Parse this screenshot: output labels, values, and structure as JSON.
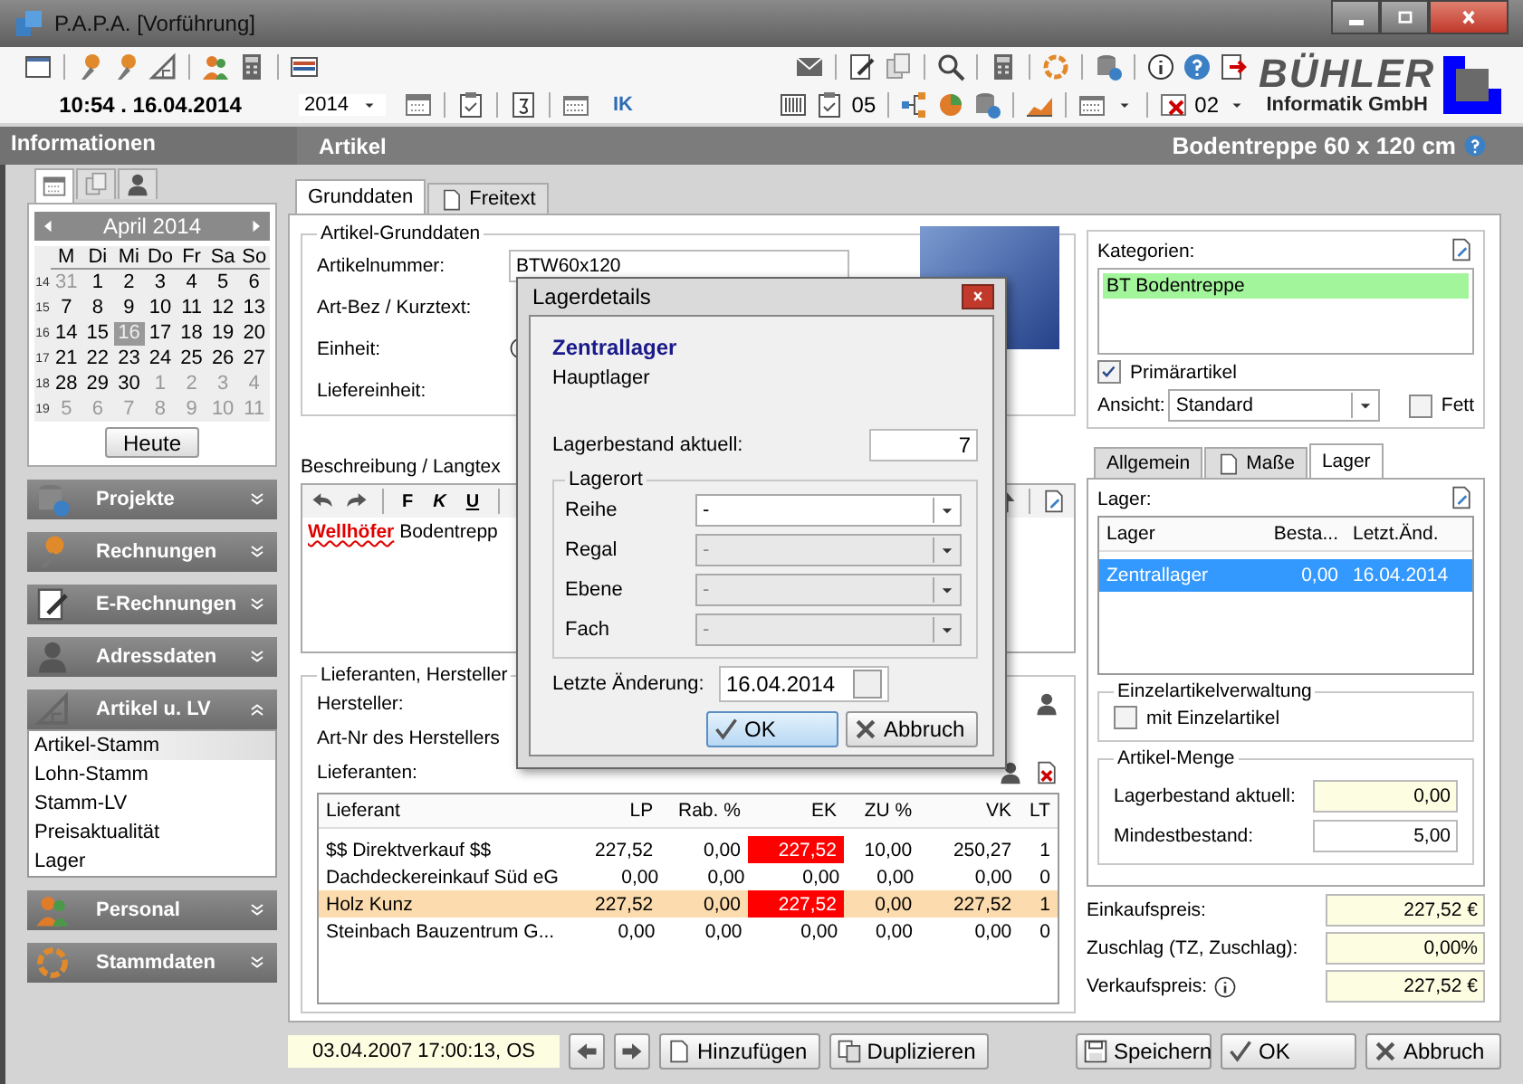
{
  "window": {
    "title": "P.A.P.A. [Vorführung]"
  },
  "toolbar": {
    "clock": "10:54 . 16.04.2014",
    "year": "2014",
    "ik": "IK",
    "count_a": "05",
    "count_b": "02"
  },
  "logo": {
    "name": "BÜHLER",
    "subtitle": "Informatik GmbH"
  },
  "info_header": "Informationen",
  "module_header": {
    "title": "Artikel",
    "item": "Bodentreppe 60 x 120 cm"
  },
  "info_tabs": [
    {
      "kind": "calendar",
      "selected": true
    },
    {
      "kind": "book",
      "selected": false
    },
    {
      "kind": "phone",
      "selected": false
    }
  ],
  "calendar": {
    "month": "April 2014",
    "weekdays": [
      "M",
      "Di",
      "Mi",
      "Do",
      "Fr",
      "Sa",
      "So"
    ],
    "today_button": "Heute",
    "weeks": [
      {
        "number": "14",
        "days": [
          {
            "day": "31",
            "outside": true,
            "selected": false
          },
          {
            "day": "1",
            "outside": false,
            "selected": false
          },
          {
            "day": "2",
            "outside": false,
            "selected": false
          },
          {
            "day": "3",
            "outside": false,
            "selected": false
          },
          {
            "day": "4",
            "outside": false,
            "selected": false
          },
          {
            "day": "5",
            "outside": false,
            "selected": false
          },
          {
            "day": "6",
            "outside": false,
            "selected": false
          }
        ]
      },
      {
        "number": "15",
        "days": [
          {
            "day": "7",
            "outside": false,
            "selected": false
          },
          {
            "day": "8",
            "outside": false,
            "selected": false
          },
          {
            "day": "9",
            "outside": false,
            "selected": false
          },
          {
            "day": "10",
            "outside": false,
            "selected": false
          },
          {
            "day": "11",
            "outside": false,
            "selected": false
          },
          {
            "day": "12",
            "outside": false,
            "selected": false
          },
          {
            "day": "13",
            "outside": false,
            "selected": false
          }
        ]
      },
      {
        "number": "16",
        "days": [
          {
            "day": "14",
            "outside": false,
            "selected": false
          },
          {
            "day": "15",
            "outside": false,
            "selected": false
          },
          {
            "day": "16",
            "outside": false,
            "selected": true
          },
          {
            "day": "17",
            "outside": false,
            "selected": false
          },
          {
            "day": "18",
            "outside": false,
            "selected": false
          },
          {
            "day": "19",
            "outside": false,
            "selected": false
          },
          {
            "day": "20",
            "outside": false,
            "selected": false
          }
        ]
      },
      {
        "number": "17",
        "days": [
          {
            "day": "21",
            "outside": false,
            "selected": false
          },
          {
            "day": "22",
            "outside": false,
            "selected": false
          },
          {
            "day": "23",
            "outside": false,
            "selected": false
          },
          {
            "day": "24",
            "outside": false,
            "selected": false
          },
          {
            "day": "25",
            "outside": false,
            "selected": false
          },
          {
            "day": "26",
            "outside": false,
            "selected": false
          },
          {
            "day": "27",
            "outside": false,
            "selected": false
          }
        ]
      },
      {
        "number": "18",
        "days": [
          {
            "day": "28",
            "outside": false,
            "selected": false
          },
          {
            "day": "29",
            "outside": false,
            "selected": false
          },
          {
            "day": "30",
            "outside": false,
            "selected": false
          },
          {
            "day": "1",
            "outside": true,
            "selected": false
          },
          {
            "day": "2",
            "outside": true,
            "selected": false
          },
          {
            "day": "3",
            "outside": true,
            "selected": false
          },
          {
            "day": "4",
            "outside": true,
            "selected": false
          }
        ]
      },
      {
        "number": "19",
        "days": [
          {
            "day": "5",
            "outside": true,
            "selected": false
          },
          {
            "day": "6",
            "outside": true,
            "selected": false
          },
          {
            "day": "7",
            "outside": true,
            "selected": false
          },
          {
            "day": "8",
            "outside": true,
            "selected": false
          },
          {
            "day": "9",
            "outside": true,
            "selected": false
          },
          {
            "day": "10",
            "outside": true,
            "selected": false
          },
          {
            "day": "11",
            "outside": true,
            "selected": false
          }
        ]
      }
    ]
  },
  "nav": [
    {
      "label": "Projekte",
      "kind": "projects",
      "expanded": false
    },
    {
      "label": "Rechnungen",
      "kind": "invoices",
      "expanded": false
    },
    {
      "label": "E-Rechnungen",
      "kind": "einvoices",
      "expanded": false
    },
    {
      "label": "Adressdaten",
      "kind": "addresses",
      "expanded": false
    },
    {
      "label": "Artikel u. LV",
      "kind": "articles",
      "expanded": true,
      "items": [
        {
          "label": "Artikel-Stamm",
          "selected": true
        },
        {
          "label": "Lohn-Stamm",
          "selected": false
        },
        {
          "label": "Stamm-LV",
          "selected": false
        },
        {
          "label": "Preisaktualität",
          "selected": false
        },
        {
          "label": "Lager",
          "selected": false
        }
      ]
    },
    {
      "label": "Personal",
      "kind": "staff",
      "expanded": false
    },
    {
      "label": "Stammdaten",
      "kind": "settings",
      "expanded": false
    }
  ],
  "main_tabs": [
    {
      "label": "Grunddaten",
      "kind": "plain",
      "selected": true
    },
    {
      "label": "Freitext",
      "kind": "page",
      "selected": false
    }
  ],
  "basics": {
    "legend": "Artikel-Grunddaten",
    "fields": [
      {
        "label": "Artikelnummer:",
        "kind": "value",
        "value": "BTW60x120"
      },
      {
        "label": "Art-Bez / Kurztext:",
        "kind": "plain"
      },
      {
        "label": "Einheit:",
        "kind": "info"
      },
      {
        "label": "Liefereinheit:",
        "kind": "plain"
      }
    ]
  },
  "description": {
    "label": "Beschreibung / Langtex",
    "format_buttons": [
      "F",
      "K",
      "U"
    ],
    "lead": "Wellhöfer",
    "text": "Bodentrepp"
  },
  "suppliers": {
    "legend": "Lieferanten, Hersteller",
    "manufacturer_label": "Hersteller:",
    "part_label": "Art-Nr des Herstellers",
    "list_label": "Lieferanten:",
    "columns": [
      "Lieferant",
      "LP",
      "Rab. %",
      "EK",
      "ZU %",
      "VK",
      "LT"
    ],
    "rows": [
      {
        "cells": [
          "$$ Direktverkauf $$",
          "227,52",
          "0,00",
          "227,52",
          "10,00",
          "250,27",
          "1"
        ],
        "ek_flag": true,
        "selected": false
      },
      {
        "cells": [
          "Dachdeckereinkauf Süd eG",
          "0,00",
          "0,00",
          "0,00",
          "0,00",
          "0,00",
          "0"
        ],
        "ek_flag": false,
        "selected": false
      },
      {
        "cells": [
          "Holz Kunz",
          "227,52",
          "0,00",
          "227,52",
          "0,00",
          "227,52",
          "1"
        ],
        "ek_flag": true,
        "selected": true
      },
      {
        "cells": [
          "Steinbach Bauzentrum G...",
          "0,00",
          "0,00",
          "0,00",
          "0,00",
          "0,00",
          "0"
        ],
        "ek_flag": false,
        "selected": false
      }
    ]
  },
  "categories": {
    "label": "Kategorien:",
    "items": [
      {
        "label": "BT Bodentreppe",
        "color": "#a3f59c"
      }
    ]
  },
  "primary": {
    "label": "Primärartikel",
    "checked": true
  },
  "view": {
    "label": "Ansicht:",
    "value": "Standard"
  },
  "bold_option": {
    "label": "Fett",
    "checked": false
  },
  "side_tabs": [
    {
      "label": "Allgemein",
      "kind": "plain",
      "selected": false
    },
    {
      "label": "Maße",
      "kind": "page",
      "selected": false
    },
    {
      "label": "Lager",
      "kind": "plain",
      "selected": true
    }
  ],
  "stock": {
    "label": "Lager:",
    "columns": [
      "Lager",
      "Besta...",
      "Letzt.Änd."
    ],
    "rows": [
      {
        "cells": [
          "Zentrallager",
          "0,00",
          "16.04.2014"
        ],
        "selected": true
      }
    ]
  },
  "single": {
    "legend": "Einzelartikelverwaltung",
    "label": "mit Einzelartikel",
    "checked": false
  },
  "quantity": {
    "legend": "Artikel-Menge",
    "fields": [
      {
        "label": "Lagerbestand aktuell:",
        "value": "0,00",
        "readonly": true
      },
      {
        "label": "Mindestbestand:",
        "value": "5,00",
        "readonly": false
      }
    ]
  },
  "prices": [
    {
      "label": "Einkaufspreis:",
      "value": "227,52 €",
      "info": false
    },
    {
      "label": "Zuschlag (TZ, Zuschlag):",
      "value": "0,00%",
      "info": false
    },
    {
      "label": "Verkaufspreis:",
      "value": "227,52 €",
      "info": true
    }
  ],
  "footer": {
    "status": "03.04.2007 17:00:13, OS",
    "buttons": [
      {
        "label": "Hinzufügen",
        "kind": "add"
      },
      {
        "label": "Duplizieren",
        "kind": "copy"
      }
    ],
    "actions": [
      {
        "label": "Speichern",
        "kind": "save"
      },
      {
        "label": "OK",
        "kind": "ok"
      },
      {
        "label": "Abbruch",
        "kind": "cancel"
      }
    ]
  },
  "dialog": {
    "title": "Lagerdetails",
    "name": "Zentrallager",
    "subtitle": "Hauptlager",
    "stock_label": "Lagerbestand aktuell:",
    "stock_value": "7",
    "location_legend": "Lagerort",
    "locations": [
      {
        "label": "Reihe",
        "value": "-",
        "disabled": false
      },
      {
        "label": "Regal",
        "value": "-",
        "disabled": true
      },
      {
        "label": "Ebene",
        "value": "-",
        "disabled": true
      },
      {
        "label": "Fach",
        "value": "-",
        "disabled": true
      }
    ],
    "changed_label": "Letzte Änderung:",
    "changed_value": "16.04.2014",
    "buttons": [
      {
        "label": "OK",
        "kind": "ok",
        "default": true
      },
      {
        "label": "Abbruch",
        "kind": "cancel",
        "default": false
      }
    ]
  }
}
